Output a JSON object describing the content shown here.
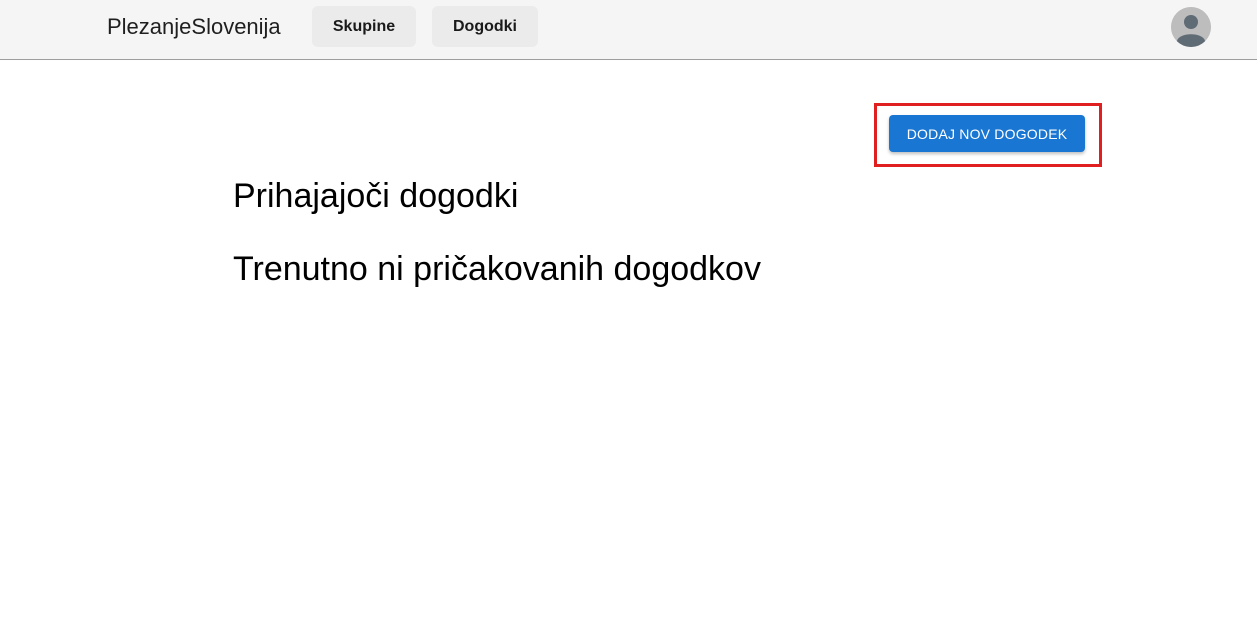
{
  "header": {
    "brand": "PlezanjeSlovenija",
    "nav": {
      "skupine": "Skupine",
      "dogodki": "Dogodki"
    },
    "avatar_icon": "user-avatar-icon"
  },
  "main": {
    "add_event_label": "DODAJ NOV DOGODEK",
    "heading": "Prihajajoči dogodki",
    "empty_message": "Trenutno ni pričakovanih dogodkov"
  },
  "colors": {
    "primary": "#1976d2",
    "highlight": "#e02020",
    "topbar": "#f5f5f5"
  }
}
